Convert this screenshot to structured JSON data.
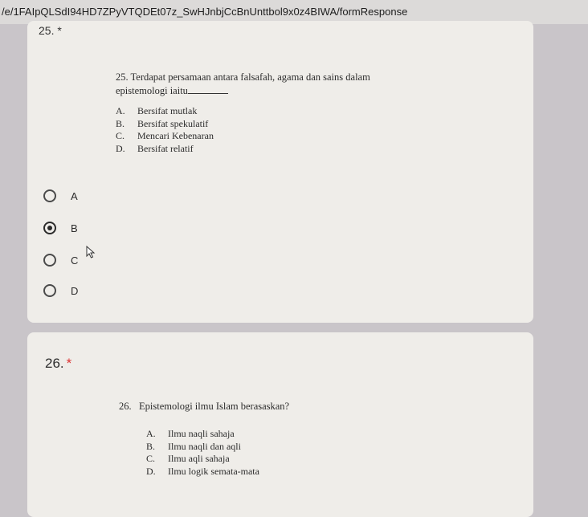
{
  "browser": {
    "url": "/e/1FAIpQLSdI94HD7ZPyVTQDEt07z_SwHJnbjCcBnUnttbol9x0z4BIWA/formResponse"
  },
  "question_25": {
    "top_label": "25. *",
    "image_text": {
      "prompt_num": "25.",
      "prompt_line1": "Terdapat persamaan antara falsafah, agama dan sains dalam",
      "prompt_line2": "epistemologi iaitu",
      "options": [
        {
          "letter": "A.",
          "text": "Bersifat mutlak"
        },
        {
          "letter": "B.",
          "text": "Bersifat spekulatif"
        },
        {
          "letter": "C.",
          "text": "Mencari Kebenaran"
        },
        {
          "letter": "D.",
          "text": "Bersifat relatif"
        }
      ]
    },
    "choices": [
      "A",
      "B",
      "C",
      "D"
    ],
    "selected": "B"
  },
  "question_26": {
    "title": "26.",
    "required_mark": "*",
    "image_text": {
      "prompt": "26.   Epistemologi ilmu Islam berasaskan?",
      "options": [
        {
          "letter": "A.",
          "text": "Ilmu naqli sahaja"
        },
        {
          "letter": "B.",
          "text": "Ilmu naqli dan aqli"
        },
        {
          "letter": "C.",
          "text": "Ilmu aqli sahaja"
        },
        {
          "letter": "D.",
          "text": "Ilmu logik semata-mata"
        }
      ]
    }
  }
}
